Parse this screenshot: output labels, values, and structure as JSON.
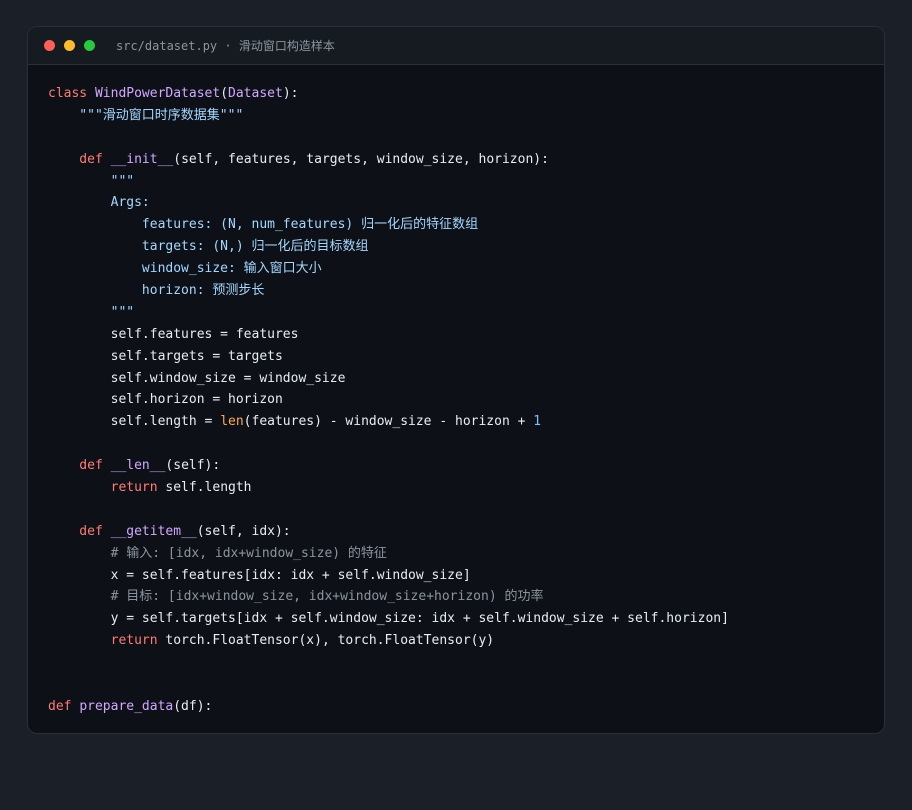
{
  "window": {
    "title": "src/dataset.py · 滑动窗口构造样本",
    "traffic_lights": [
      "close",
      "minimize",
      "zoom"
    ]
  },
  "colors": {
    "background": "#1b1f27",
    "editor_bg": "#0d1117",
    "keyword": "#ff7b72",
    "class_func": "#d2a8ff",
    "string": "#a5d6ff",
    "comment": "#8b949e",
    "number": "#79c0ff",
    "builtin": "#ffa657",
    "text": "#e6edf3"
  },
  "code_lines": [
    [
      {
        "t": "kw",
        "v": "class "
      },
      {
        "t": "cls",
        "v": "WindPowerDataset"
      },
      {
        "t": "txt",
        "v": "("
      },
      {
        "t": "cls",
        "v": "Dataset"
      },
      {
        "t": "txt",
        "v": "):"
      }
    ],
    [
      {
        "t": "str",
        "v": "    \"\"\"滑动窗口时序数据集\"\"\""
      }
    ],
    [],
    [
      {
        "t": "kw",
        "v": "    def "
      },
      {
        "t": "fn",
        "v": "__init__"
      },
      {
        "t": "txt",
        "v": "(self, features, targets, window_size, horizon):"
      }
    ],
    [
      {
        "t": "str",
        "v": "        \"\"\""
      }
    ],
    [
      {
        "t": "str",
        "v": "        Args:"
      }
    ],
    [
      {
        "t": "str",
        "v": "            features: (N, num_features) 归一化后的特征数组"
      }
    ],
    [
      {
        "t": "str",
        "v": "            targets: (N,) 归一化后的目标数组"
      }
    ],
    [
      {
        "t": "str",
        "v": "            window_size: 输入窗口大小"
      }
    ],
    [
      {
        "t": "str",
        "v": "            horizon: 预测步长"
      }
    ],
    [
      {
        "t": "str",
        "v": "        \"\"\""
      }
    ],
    [
      {
        "t": "txt",
        "v": "        self.features = features"
      }
    ],
    [
      {
        "t": "txt",
        "v": "        self.targets = targets"
      }
    ],
    [
      {
        "t": "txt",
        "v": "        self.window_size = window_size"
      }
    ],
    [
      {
        "t": "txt",
        "v": "        self.horizon = horizon"
      }
    ],
    [
      {
        "t": "txt",
        "v": "        self.length = "
      },
      {
        "t": "bi",
        "v": "len"
      },
      {
        "t": "txt",
        "v": "(features) - window_size - horizon + "
      },
      {
        "t": "num",
        "v": "1"
      }
    ],
    [],
    [
      {
        "t": "kw",
        "v": "    def "
      },
      {
        "t": "fn",
        "v": "__len__"
      },
      {
        "t": "txt",
        "v": "(self):"
      }
    ],
    [
      {
        "t": "kw",
        "v": "        return "
      },
      {
        "t": "txt",
        "v": "self.length"
      }
    ],
    [],
    [
      {
        "t": "kw",
        "v": "    def "
      },
      {
        "t": "fn",
        "v": "__getitem__"
      },
      {
        "t": "txt",
        "v": "(self, idx):"
      }
    ],
    [
      {
        "t": "cmt",
        "v": "        # 输入: [idx, idx+window_size) 的特征"
      }
    ],
    [
      {
        "t": "txt",
        "v": "        x = self.features[idx: idx + self.window_size]"
      }
    ],
    [
      {
        "t": "cmt",
        "v": "        # 目标: [idx+window_size, idx+window_size+horizon) 的功率"
      }
    ],
    [
      {
        "t": "txt",
        "v": "        y = self.targets[idx + self.window_size: idx + self.window_size + self.horizon]"
      }
    ],
    [
      {
        "t": "kw",
        "v": "        return "
      },
      {
        "t": "txt",
        "v": "torch.FloatTensor(x), torch.FloatTensor(y)"
      }
    ],
    [],
    [],
    [
      {
        "t": "kw",
        "v": "def "
      },
      {
        "t": "fn",
        "v": "prepare_data"
      },
      {
        "t": "txt",
        "v": "(df):"
      }
    ]
  ]
}
